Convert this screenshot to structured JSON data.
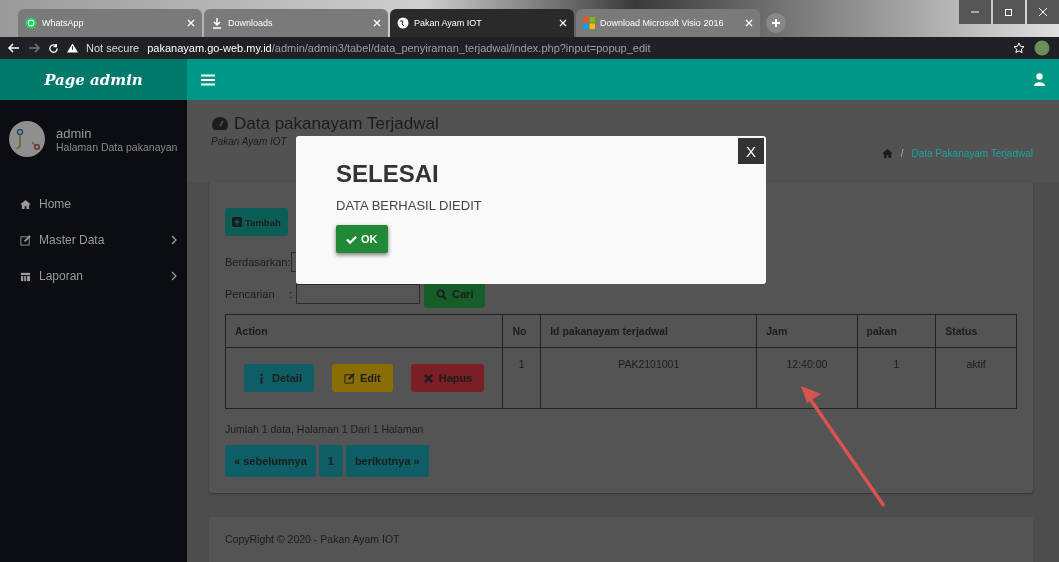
{
  "browser": {
    "tabs": [
      {
        "title": "WhatsApp",
        "selected": false
      },
      {
        "title": "Downloads",
        "selected": false
      },
      {
        "title": "Pakan Ayam IOT",
        "selected": true
      },
      {
        "title": "Download Microsoft Visio 2016",
        "selected": false
      }
    ],
    "address": {
      "security": "Not secure",
      "host": "pakanayam.go-web.my.id",
      "path": "/admin/admin3/tabel/data_penyiraman_terjadwal/index.php?input=popup_edit"
    }
  },
  "app": {
    "brand": "Page admin",
    "user": {
      "name": "admin",
      "subtitle": "Halaman Data pakanayan"
    },
    "nav": [
      {
        "label": "Home",
        "expandable": false
      },
      {
        "label": "Master Data",
        "expandable": true
      },
      {
        "label": "Laporan",
        "expandable": true
      }
    ]
  },
  "page": {
    "title": "Data pakanayam Terjadwal",
    "subtitle": "Pakan Ayam IOT",
    "breadcrumb_separator": "/",
    "breadcrumb": "Data Pakanayam Terjadwal",
    "add_button": "Tambah",
    "filter_label": "Berdasarkan:",
    "search_label": "Pencarian",
    "search_colon": ":",
    "search_button": "Cari",
    "table": {
      "columns": [
        "Action",
        "No",
        "Id pakanayam terjadwal",
        "Jam",
        "pakan",
        "Status"
      ],
      "rows": [
        {
          "cells": [
            {
              "actions": [
                {
                  "label": "Detail",
                  "kind": "info"
                },
                {
                  "label": "Edit",
                  "kind": "warning"
                },
                {
                  "label": "Hapus",
                  "kind": "danger"
                }
              ]
            },
            "1",
            "PAK2101001",
            "12:40:00",
            "1",
            "aktif"
          ]
        }
      ]
    },
    "summary": "Jumlah 1 data, Halaman 1 Dari 1 Halaman",
    "pagination": [
      "« sebelumnya",
      "1",
      "berikutnya »"
    ],
    "footer": "CopyRight © 2020 - Pakan Ayam IOT"
  },
  "modal": {
    "title": "SELESAI",
    "message": "DATA BERHASIL DIEDIT",
    "ok": "OK",
    "close": "X"
  }
}
